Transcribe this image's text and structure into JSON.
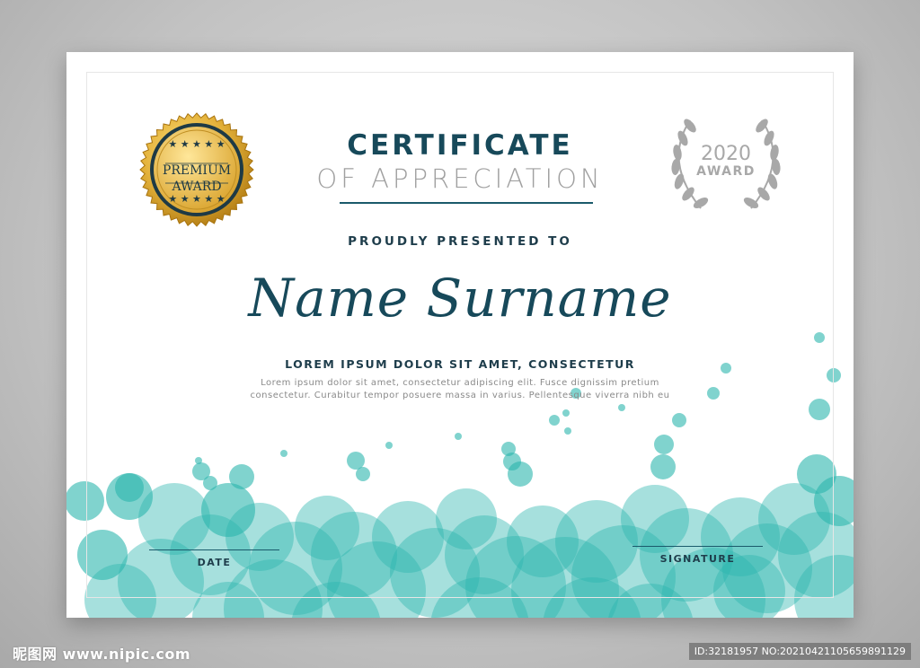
{
  "certificate": {
    "title": "CERTIFICATE",
    "subtitle": "OF APPRECIATION",
    "presented": "PROUDLY PRESENTED TO",
    "recipient": "Name Surname",
    "tagline": "LOREM IPSUM DOLOR SIT AMET, CONSECTETUR",
    "body_line1": "Lorem ipsum dolor sit amet, consectetur adipiscing elit. Fusce dignissim pretium",
    "body_line2": "consectetur. Curabitur tempor posuere massa in varius. Pellentesque viverra nibh eu",
    "date_label": "DATE",
    "signature_label": "SIGNATURE"
  },
  "badge": {
    "line1": "PREMIUM",
    "line2": "AWARD",
    "icon": "star-icon",
    "color_gold": "#d9a520"
  },
  "award": {
    "year": "2020",
    "label": "AWARD",
    "icon": "laurel-wreath-icon",
    "color": "#a8a8a8"
  },
  "colors": {
    "accent": "#17495a",
    "bubble": "#2bb5ad"
  },
  "watermark": {
    "logo": "昵图网 www.nipic.com",
    "id": "ID:32181957 NO:20210421105659891129"
  }
}
